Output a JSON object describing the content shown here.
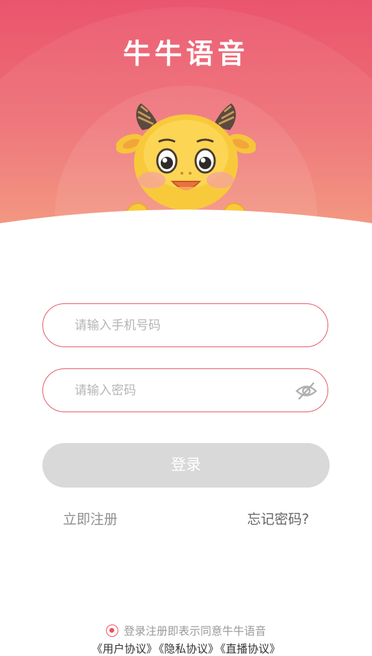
{
  "app": {
    "title": "牛牛语音"
  },
  "form": {
    "phone_placeholder": "请输入手机号码",
    "password_placeholder": "请输入密码",
    "login_label": "登录",
    "register_label": "立即注册",
    "forgot_label": "忘记密码?"
  },
  "agreement": {
    "text": "登录注册即表示同意牛牛语音",
    "links": [
      "《用户协议》",
      "《隐私协议》",
      "《直播协议》"
    ]
  },
  "colors": {
    "accent": "#e45767",
    "header_top": "#ea556e",
    "header_bottom": "#f3927a",
    "button_disabled": "#d9d9d9"
  },
  "icons": {
    "password_visibility": "eye-hidden-icon",
    "mascot": "ox-mascot"
  }
}
